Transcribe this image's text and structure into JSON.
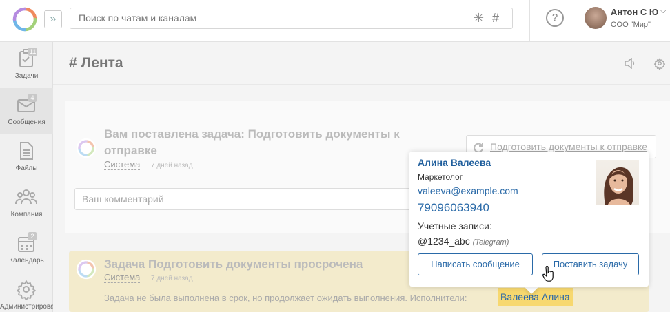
{
  "header": {
    "search_placeholder": "Поиск по чатам и каналам",
    "search_symbols": [
      "✳",
      "#"
    ],
    "help_label": "?",
    "user_name": "Антон С Ю",
    "user_org": "ООО \"Мир\""
  },
  "sidebar": {
    "items": [
      {
        "label": "Задачи",
        "badge": "11",
        "icon": "clipboard-icon"
      },
      {
        "label": "Сообщения",
        "badge": "4",
        "icon": "envelope-icon"
      },
      {
        "label": "Файлы",
        "badge": "",
        "icon": "file-icon"
      },
      {
        "label": "Компания",
        "badge": "",
        "icon": "people-icon"
      },
      {
        "label": "Календарь",
        "badge": "2",
        "icon": "calendar-icon"
      },
      {
        "label": "Администрирование",
        "badge": "",
        "icon": "gear-icon"
      }
    ]
  },
  "main": {
    "title": "# Лента",
    "card1": {
      "title_line1": "Вам поставлена задача: Подготовить документы к",
      "title_line2": "отправке",
      "author": "Система",
      "time": "7 дней назад",
      "task_link": "Подготовить документы к отправке",
      "comment_placeholder": "Ваш комментарий"
    },
    "card2": {
      "title": "Задача Подготовить документы просрочена",
      "author": "Система",
      "time": "7 дней назад",
      "description": "Задача не была выполнена в срок, но продолжает ожидать выполнения. Исполнители:",
      "assignee": "Валеева Алина"
    }
  },
  "popup": {
    "name": "Алина Валеева",
    "role": "Маркетолог",
    "email": "valeeva@example.com",
    "phone": "79096063940",
    "accounts_label": "Учетные записи:",
    "handle": "@1234_abc",
    "network": "(Telegram)",
    "btn_message": "Написать сообщение",
    "btn_task": "Поставить задачу"
  },
  "colors": {
    "accent": "#2a6aa8",
    "highlight": "#f7d86f",
    "overdue_bg": "#f3ebcc"
  }
}
